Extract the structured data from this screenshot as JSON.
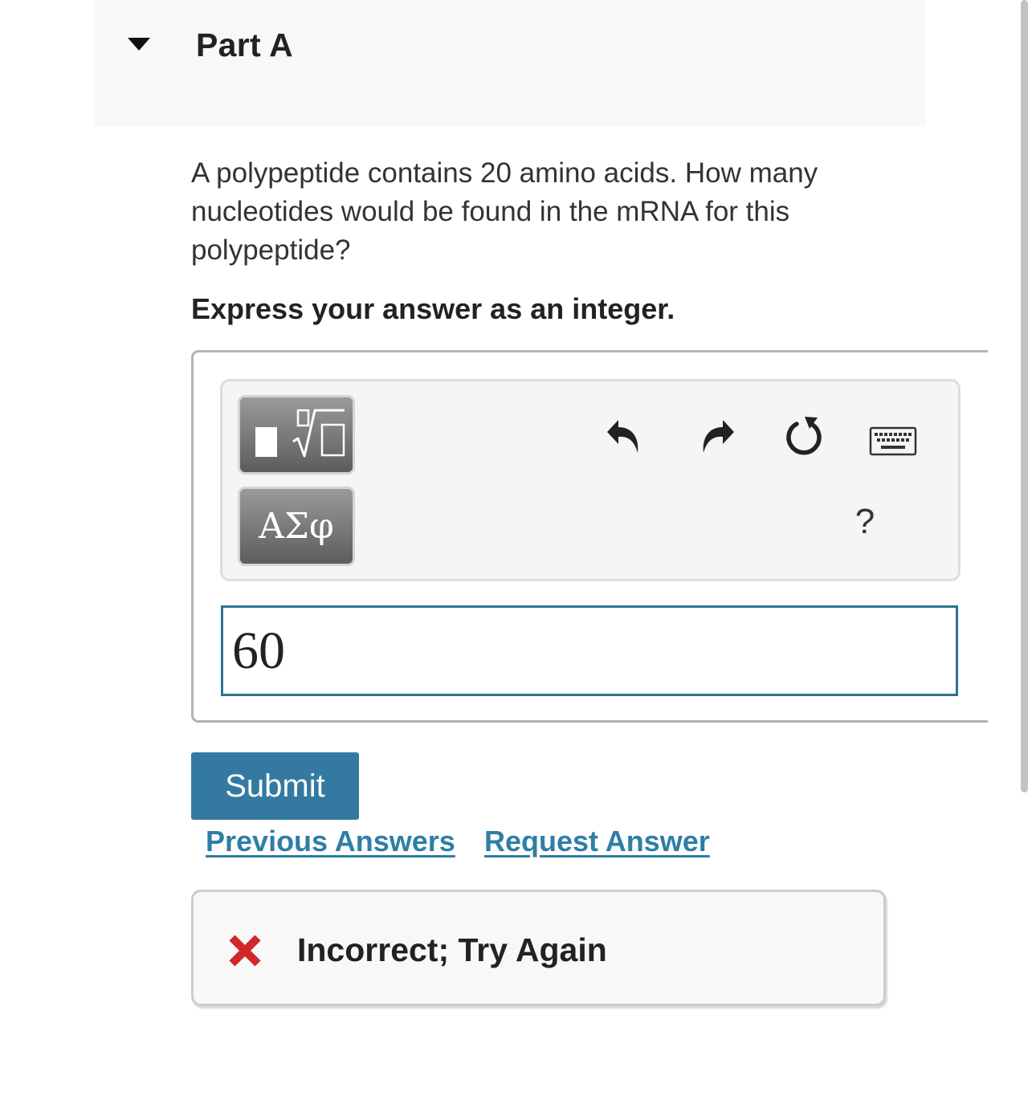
{
  "part": {
    "title": "Part A"
  },
  "question": {
    "text": "A polypeptide contains 20 amino acids. How many nucleotides would be found in the mRNA for this polypeptide?",
    "instruction": "Express your answer as an integer."
  },
  "toolbar": {
    "template_button_icon": "fraction-root-template-icon",
    "greek_button_label": "ΑΣφ",
    "undo_icon": "undo-icon",
    "redo_icon": "redo-icon",
    "reset_icon": "reset-icon",
    "keyboard_icon": "keyboard-icon",
    "help_label": "?"
  },
  "answer": {
    "value": "60"
  },
  "actions": {
    "submit_label": "Submit",
    "previous_answers_label": "Previous Answers",
    "request_answer_label": "Request Answer"
  },
  "feedback": {
    "status_icon": "x-icon",
    "message": "Incorrect; Try Again"
  },
  "colors": {
    "primary": "#347aa0",
    "link": "#2e7ea6",
    "error": "#d0272b",
    "input_border": "#2e7393"
  }
}
